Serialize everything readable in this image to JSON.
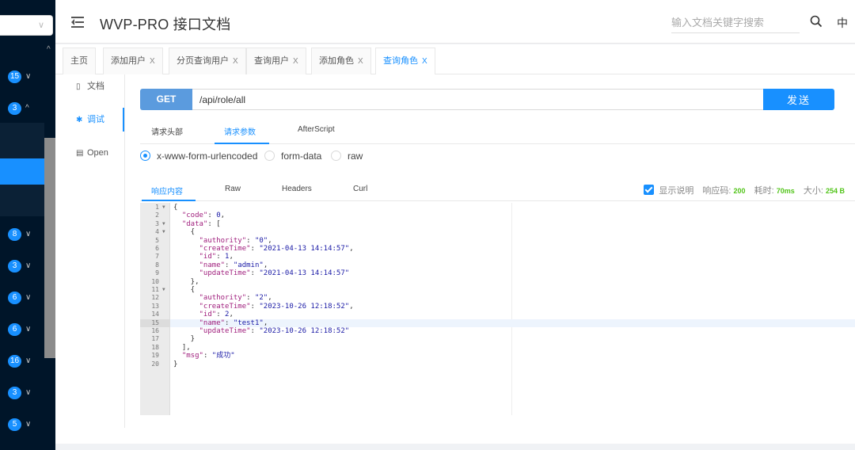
{
  "sidebar": {
    "select_chevron": "∨",
    "scroll_up": "^",
    "items": [
      {
        "badge": "15",
        "caret": "∨"
      },
      {
        "badge": "3",
        "caret": "^"
      },
      {
        "badge": "8",
        "caret": "∨"
      },
      {
        "badge": "3",
        "caret": "∨"
      },
      {
        "badge": "6",
        "caret": "∨"
      },
      {
        "badge": "6",
        "caret": "∨"
      },
      {
        "badge": "16",
        "caret": "∨"
      },
      {
        "badge": "3",
        "caret": "∨"
      },
      {
        "badge": "5",
        "caret": "∨"
      }
    ]
  },
  "header": {
    "title": "WVP-PRO 接口文档",
    "search_placeholder": "输入文档关键字搜索",
    "lang": "中"
  },
  "tabs": [
    {
      "label": "主页",
      "closable": false
    },
    {
      "label": "添加用户",
      "closable": true
    },
    {
      "label": "分页查询用户",
      "closable": true
    },
    {
      "label": "查询用户",
      "closable": true
    },
    {
      "label": "添加角色",
      "closable": true
    },
    {
      "label": "查询角色",
      "closable": true,
      "active": true
    }
  ],
  "tab_close": "X",
  "side_nav": {
    "doc": "文档",
    "debug": "调试",
    "open": "Open"
  },
  "request": {
    "method": "GET",
    "url": "/api/role/all",
    "send": "发送"
  },
  "request_tabs": {
    "headers": "请求头部",
    "params": "请求参数",
    "after_script": "AfterScript"
  },
  "body_types": {
    "urlencoded": "x-www-form-urlencoded",
    "form_data": "form-data",
    "raw": "raw"
  },
  "response_tabs": {
    "content": "响应内容",
    "raw": "Raw",
    "headers": "Headers",
    "curl": "Curl"
  },
  "response_meta": {
    "show_desc": "显示说明",
    "code_label": "响应码:",
    "code": "200",
    "time_label": "耗时:",
    "time": "70ms",
    "size_label": "大小:",
    "size": "254 B"
  },
  "code_lines": [
    "{",
    "  \"code\": 0,",
    "  \"data\": [",
    "    {",
    "      \"authority\": \"0\",",
    "      \"createTime\": \"2021-04-13 14:14:57\",",
    "      \"id\": 1,",
    "      \"name\": \"admin\",",
    "      \"updateTime\": \"2021-04-13 14:14:57\"",
    "    },",
    "    {",
    "      \"authority\": \"2\",",
    "      \"createTime\": \"2023-10-26 12:18:52\",",
    "      \"id\": 2,",
    "      \"name\": \"test1\",",
    "      \"updateTime\": \"2023-10-26 12:18:52\"",
    "    }",
    "  ],",
    "  \"msg\": \"成功\"",
    "}"
  ],
  "fold_lines": [
    1,
    3,
    4,
    11
  ],
  "highlight_line": 15,
  "colors": {
    "sidebar_bg": "#001529",
    "accent": "#1890ff",
    "method_bg": "#5b9bde",
    "success": "#52c41a",
    "json_key": "#a01f7d",
    "json_value": "#1a1aa6"
  }
}
